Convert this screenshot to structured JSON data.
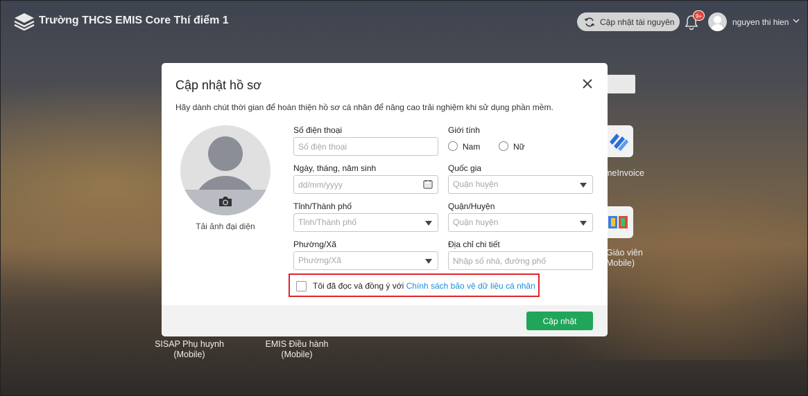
{
  "header": {
    "app_title": "Trường THCS EMIS Core Thí điểm 1",
    "sync_button": "Cập nhật tài nguyên",
    "notification_badge": "9+",
    "user_name": "nguyen thi hien"
  },
  "background_apps": [
    {
      "label": "meInvoice"
    },
    {
      "label": "Giáo viên",
      "sub": "Mobile)"
    },
    {
      "label": "SISAP Phụ huynh",
      "sub": "(Mobile)"
    },
    {
      "label": "EMIS Điều hành",
      "sub": "(Mobile)"
    }
  ],
  "modal": {
    "title": "Cập nhật hồ sơ",
    "description": "Hãy dành chút thời gian để hoàn thiện hồ sơ cá nhân để nâng cao trải nghiệm khi sử dụng phần mềm.",
    "upload_avatar_label": "Tải ảnh đại diện",
    "fields": {
      "phone": {
        "label": "Số điện thoại",
        "placeholder": "Số điện thoại",
        "value": ""
      },
      "gender": {
        "label": "Giới tính",
        "options": [
          "Nam",
          "Nữ"
        ]
      },
      "dob": {
        "label": "Ngày, tháng, năm sinh",
        "placeholder": "dd/mm/yyyy",
        "value": ""
      },
      "country": {
        "label": "Quốc gia",
        "placeholder": "Quận huyện"
      },
      "province": {
        "label": "Tỉnh/Thành phố",
        "placeholder": "Tỉnh/Thành phố"
      },
      "district": {
        "label": "Quận/Huyện",
        "placeholder": "Quận huyện"
      },
      "ward": {
        "label": "Phường/Xã",
        "placeholder": "Phường/Xã"
      },
      "address": {
        "label": "Địa chỉ chi tiết",
        "placeholder": "Nhập số nhà, đường phố",
        "value": ""
      }
    },
    "consent": {
      "text": "Tôi đã đọc và đồng ý với ",
      "link": "Chính sách bảo vệ dữ liệu cá nhân"
    },
    "submit_button": "Cập nhật"
  },
  "colors": {
    "primary_green": "#20a65a",
    "link_blue": "#1a8fd8",
    "highlight_red": "#e3222a",
    "badge_red": "#e0463d"
  }
}
